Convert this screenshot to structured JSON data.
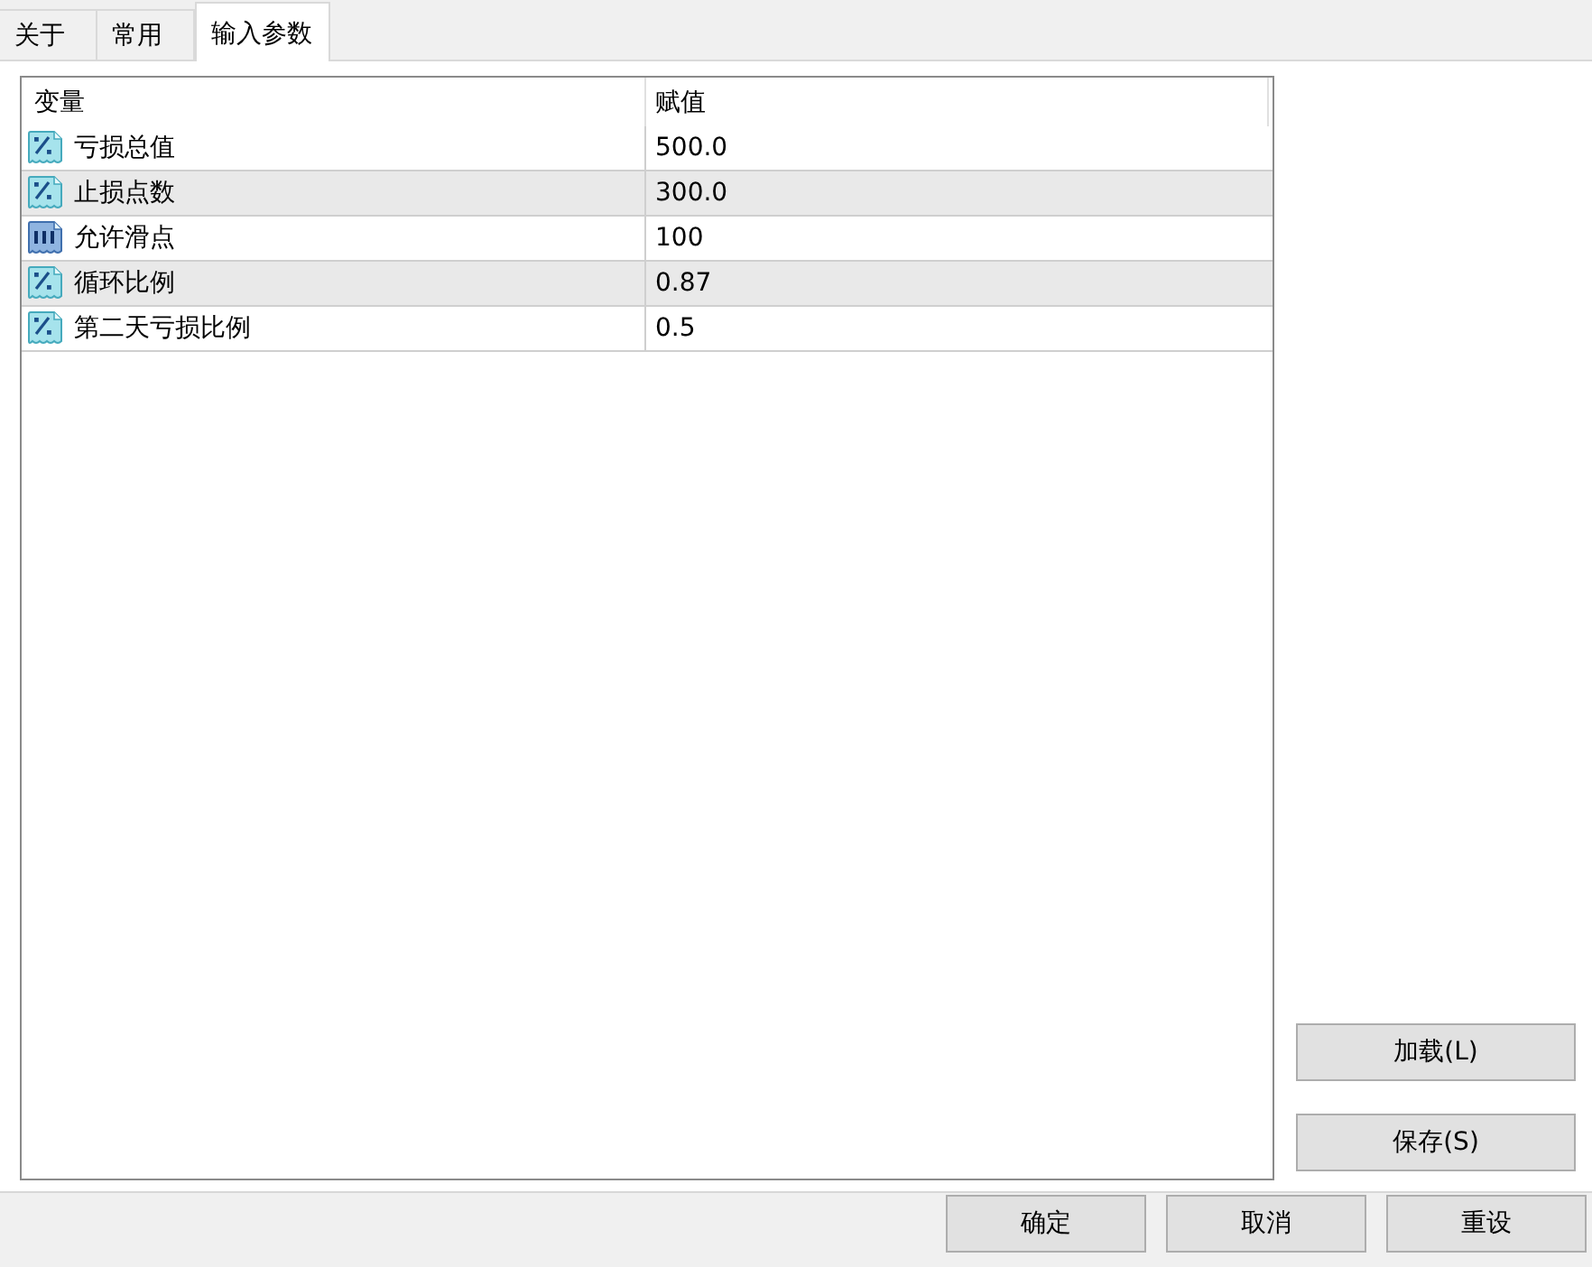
{
  "tabs": [
    {
      "label": "关于",
      "selected": false
    },
    {
      "label": "常用",
      "selected": false
    },
    {
      "label": "输入参数",
      "selected": true
    }
  ],
  "parameters": {
    "columns": [
      "变量",
      "赋值"
    ],
    "rows": [
      {
        "kind": "double",
        "name": "亏损总值",
        "value": "500.0"
      },
      {
        "kind": "double",
        "name": "止损点数",
        "value": "300.0"
      },
      {
        "kind": "int",
        "name": "允许滑点",
        "value": "100"
      },
      {
        "kind": "double",
        "name": "循环比例",
        "value": "0.87"
      },
      {
        "kind": "double",
        "name": "第二天亏损比例",
        "value": "0.5"
      }
    ]
  },
  "side_buttons": [
    "加载(L)",
    "保存(S)"
  ],
  "buttons": [
    "确定",
    "取消",
    "重设"
  ]
}
